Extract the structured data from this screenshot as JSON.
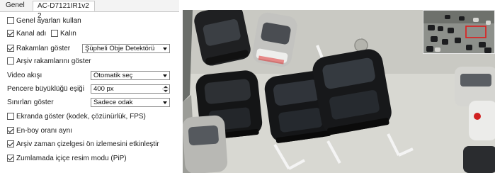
{
  "tabs": [
    "Genel",
    "AC-D7121IR1v2 2"
  ],
  "settings": {
    "general_settings": {
      "label": "Genel ayarları kullan",
      "checked": false
    },
    "channel_name": {
      "label": "Kanal adı",
      "checked": true
    },
    "bold": {
      "label": "Kalın",
      "checked": false
    },
    "show_numbers": {
      "label": "Rakamları göster",
      "checked": true,
      "value": "Şüpheli Obje Detektörü"
    },
    "show_archive_numbers": {
      "label": "Arşiv rakamlarını göster",
      "checked": false
    },
    "video_stream": {
      "label": "Video akışı",
      "value": "Otomatik seç"
    },
    "window_size_threshold": {
      "label": "Pencere büyüklüğü eşiği",
      "value": "400 px"
    },
    "show_borders": {
      "label": "Sınırları göster",
      "value": "Sadece odak"
    },
    "show_on_screen": {
      "label": "Ekranda göster (kodek, çözünürlük, FPS)",
      "checked": false
    },
    "aspect_ratio": {
      "label": "En-boy oranı aynı",
      "checked": true
    },
    "archive_timeline_preview": {
      "label": "Arşiv zaman çizelgesi ön izlemesini etkinleştir",
      "checked": true
    },
    "zoom_pip": {
      "label": "Zumlamada içiçe resim modu (PiP)",
      "checked": true
    }
  },
  "colors": {
    "accent_red": "#e01b1b",
    "panel_bg": "#ffffff",
    "tab_bar_bg": "#f3f3f3"
  }
}
